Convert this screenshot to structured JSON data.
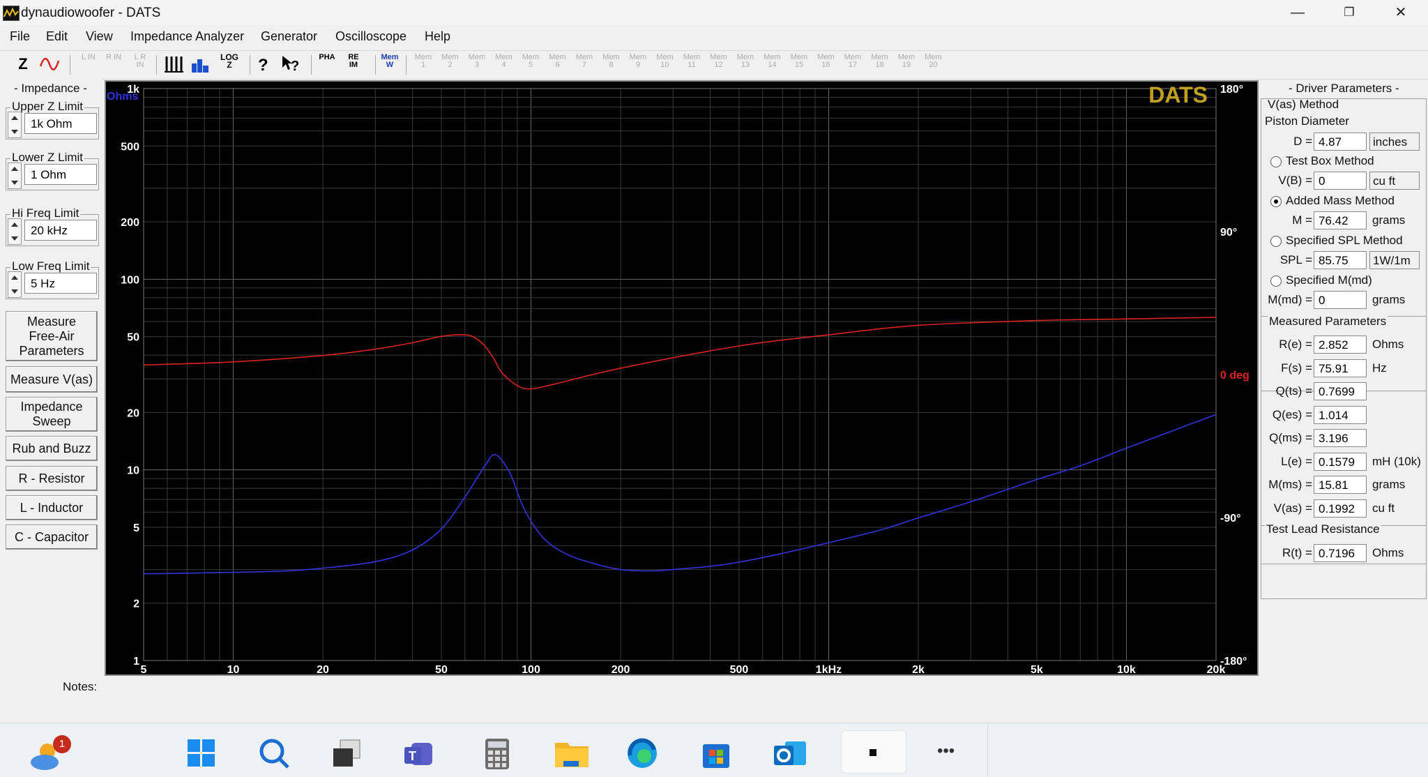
{
  "window": {
    "title": "dynaudiowoofer - DATS",
    "minimize": "—",
    "maximize": "❐",
    "close": "✕"
  },
  "menu": [
    "File",
    "Edit",
    "View",
    "Impedance Analyzer",
    "Generator",
    "Oscilloscope",
    "Help"
  ],
  "toolbar": {
    "z_label": "Z",
    "lin_labels": [
      "L IN",
      "R IN",
      "L R IN"
    ],
    "log_label": "LOG Z",
    "pha_label": "PHA",
    "reim_label": "RE IM",
    "memw_label": "Mem W",
    "mem_slots": [
      "Mem 1",
      "Mem 2",
      "Mem 3",
      "Mem 4",
      "Mem 5",
      "Mem 6",
      "Mem 7",
      "Mem 8",
      "Mem 9",
      "Mem 10",
      "Mem 11",
      "Mem 12",
      "Mem 13",
      "Mem 14",
      "Mem 15",
      "Mem 16",
      "Mem 17",
      "Mem 18",
      "Mem 19",
      "Mem 20"
    ]
  },
  "left_panel": {
    "impedance_header": "- Impedance -",
    "upper_z": {
      "label": "Upper Z Limit",
      "value": "1k Ohm"
    },
    "lower_z": {
      "label": "Lower Z Limit",
      "value": "1 Ohm"
    },
    "hi_freq": {
      "label": "Hi Freq Limit",
      "value": "20 kHz"
    },
    "low_freq": {
      "label": "Low Freq Limit",
      "value": "5 Hz"
    },
    "buttons": {
      "free_air_1": "Measure",
      "free_air_2": "Free-Air",
      "free_air_3": "Parameters",
      "vas": "Measure V(as)",
      "sweep_1": "Impedance",
      "sweep_2": "Sweep",
      "rub": "Rub and Buzz",
      "resistor": "R - Resistor",
      "inductor": "L - Inductor",
      "capacitor": "C - Capacitor"
    }
  },
  "chart_data": {
    "type": "line",
    "watermark": "DATS",
    "x_scale": "log",
    "xlim": [
      5,
      20000
    ],
    "x_ticks": [
      5,
      10,
      20,
      50,
      100,
      200,
      500,
      1000,
      2000,
      5000,
      10000,
      20000
    ],
    "x_tick_labels": [
      "5",
      "10",
      "20",
      "50",
      "100",
      "200",
      "500",
      "1kHz",
      "2k",
      "5k",
      "10k",
      "20k"
    ],
    "y_scale": "log",
    "ylim": [
      1,
      1000
    ],
    "ylabel": "Ohms",
    "y_ticks": [
      1,
      2,
      5,
      10,
      20,
      50,
      100,
      200,
      500,
      1000
    ],
    "y_tick_labels": [
      "1",
      "2",
      "5",
      "10",
      "20",
      "50",
      "100",
      "200",
      "500",
      "1k"
    ],
    "y2_unit": "deg",
    "y2lim": [
      -180,
      180
    ],
    "y2_ticks": [
      180,
      90,
      0,
      -90,
      -180
    ],
    "y2_tick_labels": [
      "180°",
      "90°",
      "0 deg",
      "-90°",
      "-180°"
    ],
    "grid": true,
    "colors": {
      "impedance": "#3333dd",
      "phase": "#dd2222",
      "background": "#000000",
      "grid": "#555555",
      "watermark": "#bfa020"
    },
    "series": [
      {
        "name": "Impedance",
        "axis": "left",
        "x": [
          5,
          7,
          10,
          15,
          20,
          30,
          40,
          50,
          60,
          70,
          76,
          85,
          95,
          110,
          130,
          160,
          200,
          250,
          300,
          400,
          500,
          700,
          1000,
          1500,
          2000,
          3000,
          5000,
          7000,
          10000,
          15000,
          20000
        ],
        "y": [
          2.85,
          2.87,
          2.9,
          2.95,
          3.05,
          3.3,
          3.8,
          4.9,
          7.2,
          10.5,
          12.0,
          9.6,
          6.2,
          4.4,
          3.65,
          3.25,
          3.0,
          2.95,
          3.0,
          3.12,
          3.28,
          3.65,
          4.15,
          4.85,
          5.6,
          6.8,
          8.9,
          10.5,
          13.0,
          16.5,
          19.5
        ]
      },
      {
        "name": "Phase",
        "axis": "right",
        "x": [
          5,
          10,
          20,
          30,
          40,
          50,
          60,
          65,
          70,
          75,
          80,
          90,
          100,
          120,
          200,
          500,
          1000,
          2000,
          5000,
          10000,
          20000
        ],
        "y": [
          6,
          8,
          12,
          16,
          20,
          24,
          25,
          23,
          18,
          10,
          1,
          -7,
          -9,
          -6,
          4,
          18,
          25,
          31,
          34,
          35,
          36
        ]
      }
    ]
  },
  "notes_label": "Notes:",
  "right_panel": {
    "driver_header": "- Driver Parameters -",
    "vas_method": "V(as) Method",
    "piston_diameter": "Piston Diameter",
    "d": {
      "label": "D =",
      "value": "4.87",
      "unit": "inches"
    },
    "test_box": {
      "label": "Test Box Method",
      "selected": false
    },
    "vb": {
      "label": "V(B) =",
      "value": "0",
      "unit": "cu ft"
    },
    "added_mass": {
      "label": "Added Mass Method",
      "selected": true
    },
    "m": {
      "label": "M =",
      "value": "76.42",
      "unit": "grams"
    },
    "spl_method": {
      "label": "Specified SPL Method",
      "selected": false
    },
    "spl": {
      "label": "SPL =",
      "value": "85.75",
      "unit": "1W/1m"
    },
    "mmd_method": {
      "label": "Specified M(md)",
      "selected": false
    },
    "mmd": {
      "label": "M(md) =",
      "value": "0",
      "unit": "grams"
    },
    "measured_header": "Measured Parameters",
    "measured": [
      {
        "label": "R(e) =",
        "value": "2.852",
        "unit": "Ohms"
      },
      {
        "label": "F(s) =",
        "value": "75.91",
        "unit": "Hz"
      },
      {
        "label": "Q(ts) =",
        "value": "0.7699",
        "unit": ""
      },
      {
        "label": "Q(es) =",
        "value": "1.014",
        "unit": ""
      },
      {
        "label": "Q(ms) =",
        "value": "3.196",
        "unit": ""
      },
      {
        "label": "L(e) =",
        "value": "0.1579",
        "unit": "mH (10k)"
      },
      {
        "label": "M(ms) =",
        "value": "15.81",
        "unit": "grams"
      },
      {
        "label": "V(as) =",
        "value": "0.1992",
        "unit": "cu ft"
      }
    ],
    "lead_header": "Test Lead Resistance",
    "rt": {
      "label": "R(t) =",
      "value": "0.7196",
      "unit": "Ohms"
    }
  },
  "taskbar": {
    "weather_badge": "1",
    "more": "•••",
    "icons": [
      "weather-icon",
      "start-icon",
      "search-icon",
      "taskview-icon",
      "teams-icon",
      "calculator-icon",
      "file-explorer-icon",
      "edge-icon",
      "store-icon",
      "outlook-icon",
      "dats-app-icon"
    ]
  }
}
